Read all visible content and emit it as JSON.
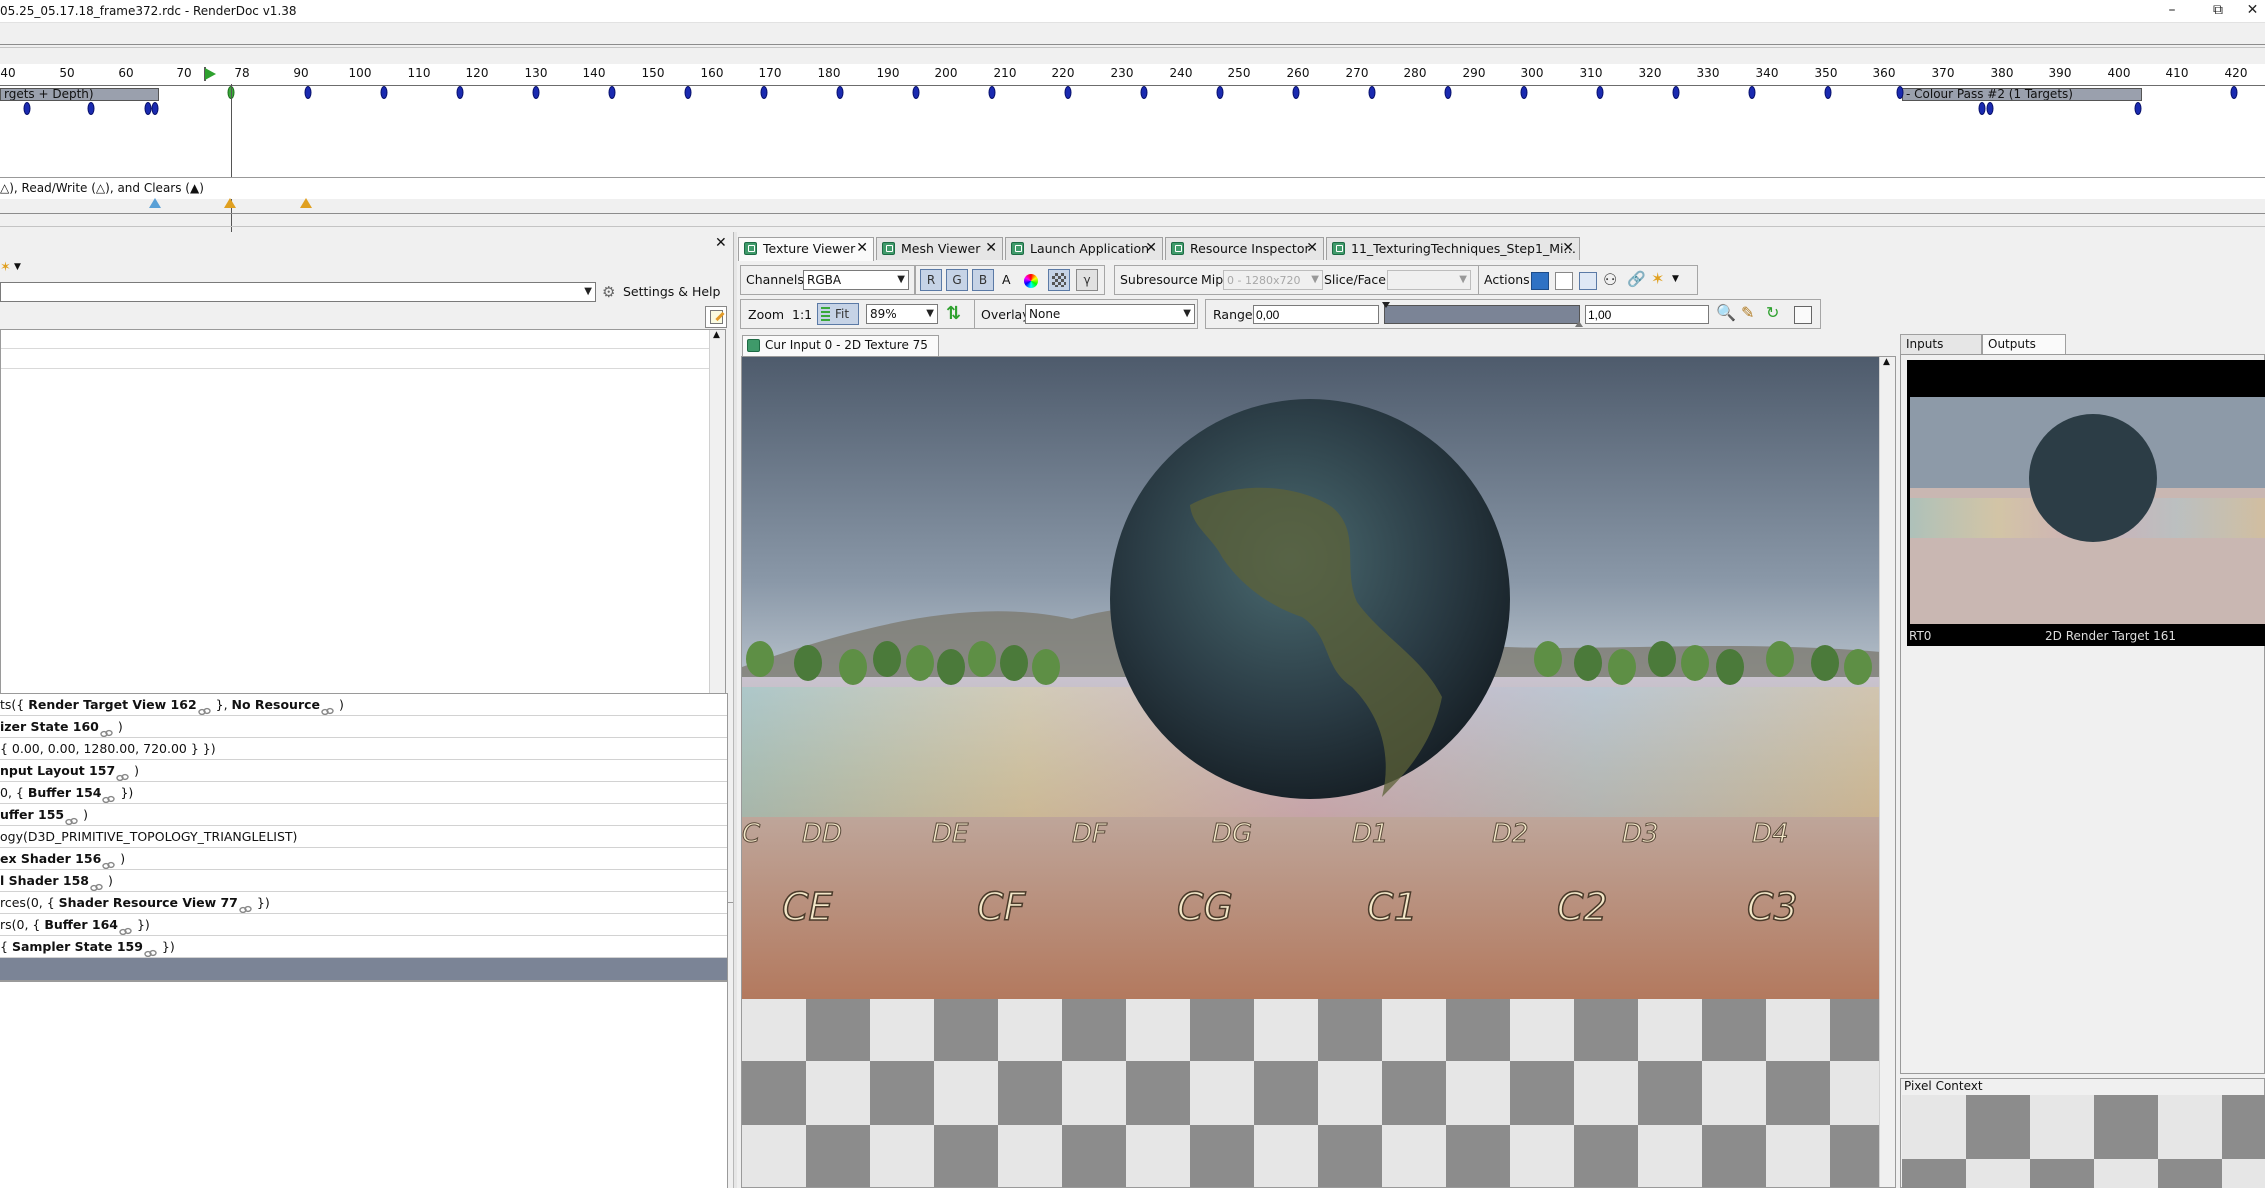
{
  "window": {
    "title": "05.25_05.17.18_frame372.rdc - RenderDoc v1.38",
    "minimize": "–",
    "maximize": "⧉",
    "close": "✕"
  },
  "timeline": {
    "ruler": [
      "40",
      "50",
      "60",
      "70",
      "78",
      "90",
      "100",
      "110",
      "120",
      "130",
      "140",
      "150",
      "160",
      "170",
      "180",
      "190",
      "200",
      "210",
      "220",
      "230",
      "240",
      "250",
      "260",
      "270",
      "280",
      "290",
      "300",
      "310",
      "320",
      "330",
      "340",
      "350",
      "360",
      "370",
      "380",
      "390",
      "400",
      "410",
      "420"
    ],
    "passes": [
      {
        "label": "rgets + Depth)"
      },
      {
        "label": "- Colour Pass #2 (1 Targets)"
      }
    ],
    "usage_legend": "△), Read/Write (△), and Clears (▲)"
  },
  "left_panel": {
    "settings_help": "Settings & Help"
  },
  "api_inspector": {
    "rows": [
      {
        "pre": "ts({ ",
        "b1": "Render Target View 162",
        "mid": " }, ",
        "b2": "No Resource",
        "post": " )"
      },
      {
        "pre": "",
        "b1": "izer State 160",
        "mid": " )",
        "b2": "",
        "post": ""
      },
      {
        "pre": "{ 0.00, 0.00, 1280.00, 720.00 } })",
        "b1": "",
        "mid": "",
        "b2": "",
        "post": ""
      },
      {
        "pre": "",
        "b1": "nput Layout 157",
        "mid": " )",
        "b2": "",
        "post": ""
      },
      {
        "pre": "0, { ",
        "b1": "Buffer 154",
        "mid": " })",
        "b2": "",
        "post": ""
      },
      {
        "pre": "",
        "b1": "uffer 155",
        "mid": " )",
        "b2": "",
        "post": ""
      },
      {
        "pre": "ogy(D3D_PRIMITIVE_TOPOLOGY_TRIANGLELIST)",
        "b1": "",
        "mid": "",
        "b2": "",
        "post": ""
      },
      {
        "pre": "",
        "b1": "ex Shader 156",
        "mid": " )",
        "b2": "",
        "post": ""
      },
      {
        "pre": "",
        "b1": "l Shader 158",
        "mid": " )",
        "b2": "",
        "post": ""
      },
      {
        "pre": "rces(0, { ",
        "b1": "Shader Resource View 77",
        "mid": " })",
        "b2": "",
        "post": ""
      },
      {
        "pre": "rs(0, { ",
        "b1": "Buffer 164",
        "mid": " })",
        "b2": "",
        "post": ""
      },
      {
        "pre": "{ ",
        "b1": "Sampler State 159",
        "mid": " })",
        "b2": "",
        "post": ""
      },
      {
        "pre": "",
        "b1": "",
        "mid": "",
        "b2": "",
        "post": ""
      }
    ]
  },
  "tabs": [
    {
      "label": "Texture Viewer",
      "active": true
    },
    {
      "label": "Mesh Viewer"
    },
    {
      "label": "Launch Application"
    },
    {
      "label": "Resource Inspector"
    },
    {
      "label": "11_TexturingTechniques_Step1_Mi…"
    }
  ],
  "texture_viewer": {
    "channels_label": "Channels",
    "channels_value": "RGBA",
    "btn_r": "R",
    "btn_g": "G",
    "btn_b": "B",
    "btn_a": "A",
    "subresource_label": "Subresource",
    "mip_label": "Mip",
    "mip_value": "0 - 1280x720",
    "slice_label": "Slice/Face",
    "actions_label": "Actions",
    "zoom_label": "Zoom",
    "zoom_11": "1:1",
    "fit_label": "Fit",
    "zoom_value": "89%",
    "overlay_label": "Overlay",
    "overlay_value": "None",
    "range_label": "Range",
    "range_min": "0,00",
    "range_max": "1,00",
    "gamma_btn": "γ",
    "canvas_tab": "Cur Input 0 - 2D Texture 75",
    "floor_labels_row1": [
      "C",
      "DD",
      "DE",
      "DF",
      "DG",
      "D1",
      "D2",
      "D3",
      "D4"
    ],
    "floor_labels_row2": [
      "CE",
      "CF",
      "CG",
      "C1",
      "C2",
      "C3"
    ]
  },
  "right_panel": {
    "tab_inputs": "Inputs",
    "tab_outputs": "Outputs",
    "thumb_slot": "RT0",
    "thumb_name": "2D Render Target 161",
    "pixel_context": "Pixel Context"
  },
  "colors": {
    "marker_blue": "#1a2ab0",
    "marker_green": "#3aa83a",
    "selection": "#7b8496",
    "tab_icon": "#3f9a6a"
  }
}
